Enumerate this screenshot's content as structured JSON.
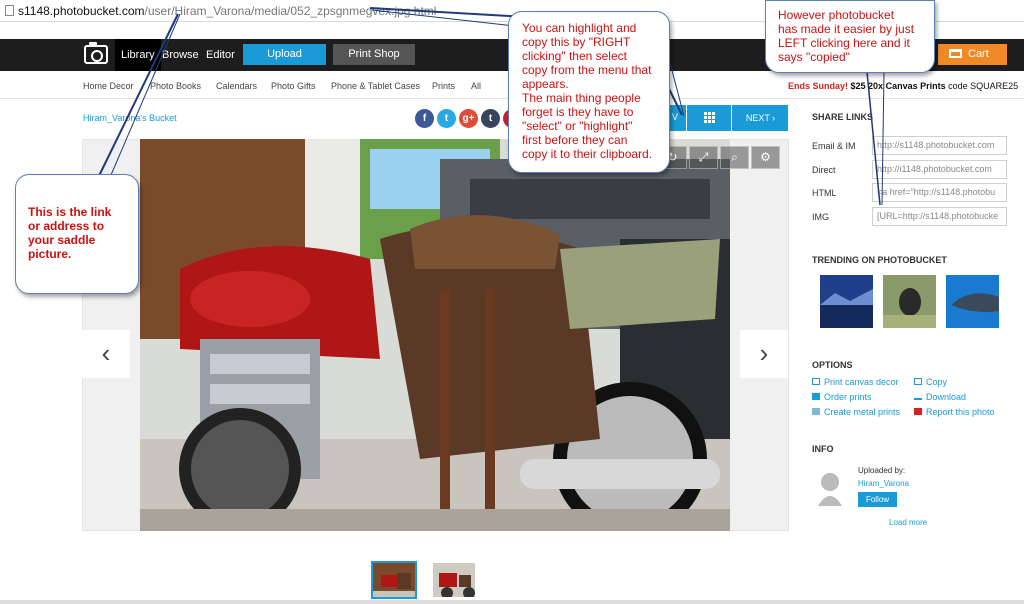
{
  "address_bar": {
    "host": "s1148.photobucket.com",
    "path": "/user/Hiram_Varona/media/052_zpsgnmegvex.jpg.html"
  },
  "top_nav": {
    "logo_icon": "camera-icon",
    "items": [
      "Library",
      "Browse",
      "Editor"
    ],
    "upload": "Upload",
    "print_shop": "Print Shop",
    "cart": "Cart",
    "cart_icon": "shopping-cart-icon",
    "colors": {
      "bar": "#1d1d1d",
      "upload": "#1a9ad6",
      "print_shop": "#555555",
      "cart": "#f08a28"
    }
  },
  "sub_nav": {
    "items": [
      "Home Decor",
      "Photo Books",
      "Calendars",
      "Photo Gifts",
      "Phone & Tablet Cases",
      "Prints",
      "All"
    ],
    "promo": {
      "highlight": "Ends Sunday!",
      "price": "$25 20x",
      "product": "Canvas Prints",
      "code_text": "code SQUARE25"
    }
  },
  "media": {
    "breadcrumb": "Hiram_Varona's Bucket",
    "share_icons": [
      "facebook-icon",
      "twitter-icon",
      "google-plus-icon",
      "tumblr-icon",
      "pinterest-icon"
    ],
    "share_letters": [
      "f",
      "t",
      "g+",
      "t",
      "p"
    ],
    "slideshow_partial": "V",
    "next": "NEXT ›",
    "prev_arrow": "‹",
    "next_arrow": "›"
  },
  "share_links": {
    "title": "SHARE LINKS",
    "rows": [
      {
        "label": "Email & IM",
        "value": "http://s1148.photobucket.com"
      },
      {
        "label": "Direct",
        "value": "http://i1148.photobucket.com"
      },
      {
        "label": "HTML",
        "value": "<a href=\"http://s1148.photobu"
      },
      {
        "label": "IMG",
        "value": "[URL=http://s1148.photobucke"
      }
    ]
  },
  "trending": {
    "title": "TRENDING ON PHOTOBUCKET"
  },
  "options": {
    "title": "OPTIONS",
    "left": [
      "Print canvas decor",
      "Order prints",
      "Create metal prints"
    ],
    "right": [
      "Copy",
      "Download",
      "Report this photo"
    ]
  },
  "info": {
    "title": "INFO",
    "uploaded_by": "Uploaded by:",
    "uploader": "Hiram_Varona",
    "follow": "Follow",
    "load_more": "Load more"
  },
  "callouts": {
    "link": "This is the link\nor address to\nyour saddle\npicture.",
    "highlight": "You can highlight and\ncopy this by \"RIGHT\nclicking\" then select\ncopy from the menu that\nappears.\nThe main thing people\nforget is they have to\n\"select\" or \"highlight\"\nfirst before they can\ncopy it to their clipboard.",
    "copied": "However photobucket\nhas made it easier by just\nLEFT clicking here and it\nsays \"copied\""
  }
}
